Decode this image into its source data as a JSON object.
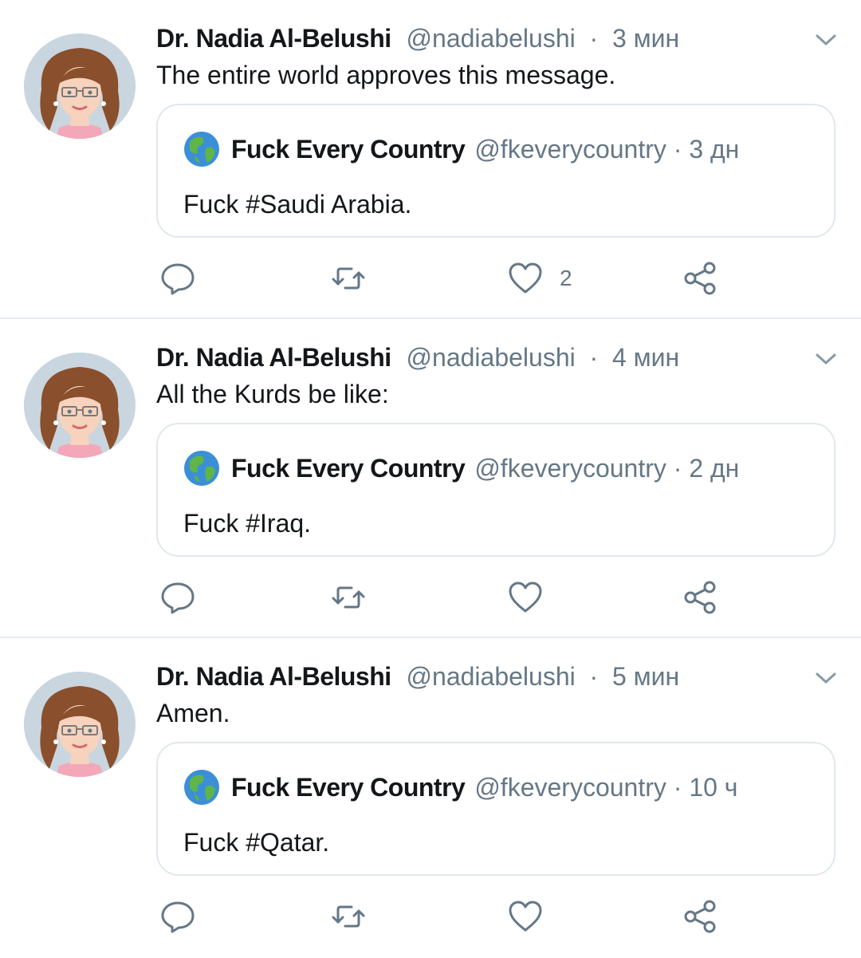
{
  "colors": {
    "text_primary": "#14171a",
    "text_secondary": "#657786",
    "border": "#e1e8ed",
    "divider": "#e6ecf0"
  },
  "icons": {
    "chevron": "chevron-down-icon",
    "reply": "reply-icon",
    "retweet": "retweet-icon",
    "like": "heart-icon",
    "share": "share-icon",
    "quoted_avatar": "globe-icon"
  },
  "tweets": [
    {
      "author_name": "Dr. Nadia Al-Belushi",
      "author_handle": "@nadiabelushi",
      "separator": "·",
      "time": "3 мин",
      "text": "The entire world approves this message.",
      "quoted": {
        "author_name": "Fuck Every Country",
        "author_handle": "@fkeverycountry",
        "separator": "·",
        "time": "3 дн",
        "text": "Fuck #Saudi Arabia."
      },
      "like_count": "2"
    },
    {
      "author_name": "Dr. Nadia Al-Belushi",
      "author_handle": "@nadiabelushi",
      "separator": "·",
      "time": "4 мин",
      "text": "All the Kurds be like:",
      "quoted": {
        "author_name": "Fuck Every Country",
        "author_handle": "@fkeverycountry",
        "separator": "·",
        "time": "2 дн",
        "text": "Fuck #Iraq."
      },
      "like_count": ""
    },
    {
      "author_name": "Dr. Nadia Al-Belushi",
      "author_handle": "@nadiabelushi",
      "separator": "·",
      "time": "5 мин",
      "text": "Amen.",
      "quoted": {
        "author_name": "Fuck Every Country",
        "author_handle": "@fkeverycountry",
        "separator": "·",
        "time": "10 ч",
        "text": "Fuck #Qatar."
      },
      "like_count": ""
    }
  ]
}
